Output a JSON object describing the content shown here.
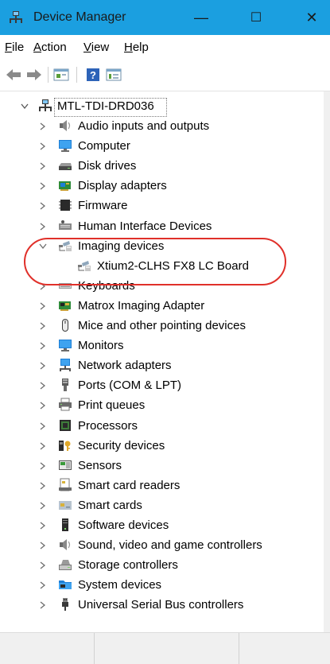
{
  "window": {
    "title": "Device Manager",
    "minimize": "—",
    "maximize": "☐",
    "close": "✕"
  },
  "menu": [
    {
      "label": "File",
      "accel": "F",
      "rest": "ile"
    },
    {
      "label": "Action",
      "accel": "A",
      "rest": "ction"
    },
    {
      "label": "View",
      "accel": "V",
      "rest": "iew"
    },
    {
      "label": "Help",
      "accel": "H",
      "rest": "elp"
    }
  ],
  "toolbar": {
    "icons": [
      "back-arrow-icon",
      "forward-arrow-icon",
      "properties-icon",
      "help-icon",
      "show-hidden-icon"
    ]
  },
  "tree": {
    "root": {
      "label": "MTL-TDI-DRD036",
      "icon": "computer-network-icon",
      "expanded": true
    },
    "categories": [
      {
        "label": "Audio inputs and outputs",
        "icon": "speaker-icon",
        "expanded": false
      },
      {
        "label": "Computer",
        "icon": "monitor-icon",
        "expanded": false
      },
      {
        "label": "Disk drives",
        "icon": "disk-drive-icon",
        "expanded": false
      },
      {
        "label": "Display adapters",
        "icon": "display-adapter-icon",
        "expanded": false
      },
      {
        "label": "Firmware",
        "icon": "firmware-icon",
        "expanded": false
      },
      {
        "label": "Human Interface Devices",
        "icon": "hid-icon",
        "expanded": false
      },
      {
        "label": "Imaging devices",
        "icon": "camera-icon",
        "expanded": true,
        "children": [
          {
            "label": "Xtium2-CLHS FX8 LC Board",
            "icon": "camera-icon"
          }
        ]
      },
      {
        "label": "Keyboards",
        "icon": "keyboard-icon",
        "expanded": false
      },
      {
        "label": "Matrox Imaging Adapter",
        "icon": "adapter-card-icon",
        "expanded": false
      },
      {
        "label": "Mice and other pointing devices",
        "icon": "mouse-icon",
        "expanded": false
      },
      {
        "label": "Monitors",
        "icon": "monitor-icon",
        "expanded": false
      },
      {
        "label": "Network adapters",
        "icon": "network-icon",
        "expanded": false
      },
      {
        "label": "Ports (COM & LPT)",
        "icon": "port-icon",
        "expanded": false
      },
      {
        "label": "Print queues",
        "icon": "printer-icon",
        "expanded": false
      },
      {
        "label": "Processors",
        "icon": "processor-icon",
        "expanded": false
      },
      {
        "label": "Security devices",
        "icon": "security-key-icon",
        "expanded": false
      },
      {
        "label": "Sensors",
        "icon": "sensor-icon",
        "expanded": false
      },
      {
        "label": "Smart card readers",
        "icon": "smart-card-reader-icon",
        "expanded": false
      },
      {
        "label": "Smart cards",
        "icon": "smart-card-icon",
        "expanded": false
      },
      {
        "label": "Software devices",
        "icon": "software-device-icon",
        "expanded": false
      },
      {
        "label": "Sound, video and game controllers",
        "icon": "speaker-icon",
        "expanded": false
      },
      {
        "label": "Storage controllers",
        "icon": "storage-controller-icon",
        "expanded": false
      },
      {
        "label": "System devices",
        "icon": "system-folder-icon",
        "expanded": false
      },
      {
        "label": "Universal Serial Bus controllers",
        "icon": "usb-icon",
        "expanded": false
      }
    ]
  },
  "colors": {
    "titlebar": "#1b9fe0",
    "highlight_ring": "#e0302a",
    "selection_border": "#7a7a7a"
  }
}
